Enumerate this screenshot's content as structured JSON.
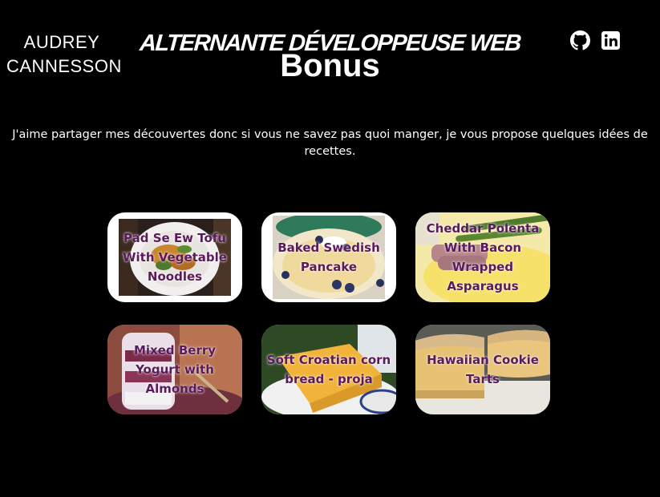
{
  "header": {
    "brand_line1": "AUDREY",
    "brand_line2": "CANNESSON",
    "subtitle": "ALTERNANTE DÉVELOPPEUSE WEB",
    "title": "Bonus",
    "social": [
      {
        "name": "github-icon"
      },
      {
        "name": "linkedin-icon"
      }
    ]
  },
  "intro": {
    "line1": "J'aime partager mes découvertes donc si vous ne savez pas quoi manger, je vous propose quelques idées de",
    "line2": "recettes."
  },
  "recipes": [
    {
      "label": "Pad Se Ew Tofu With Vegetable Noodles"
    },
    {
      "label": "Baked Swedish Pancake"
    },
    {
      "label": "Cheddar Polenta With Bacon Wrapped Asparagus"
    },
    {
      "label": "Mixed Berry Yogurt with Almonds"
    },
    {
      "label": "Soft Croatian corn bread - proja"
    },
    {
      "label": "Hawaiian Cookie Tarts"
    }
  ],
  "colors": {
    "background": "#000000",
    "text": "#ffffff",
    "recipe_label": "#5a1a5c"
  }
}
